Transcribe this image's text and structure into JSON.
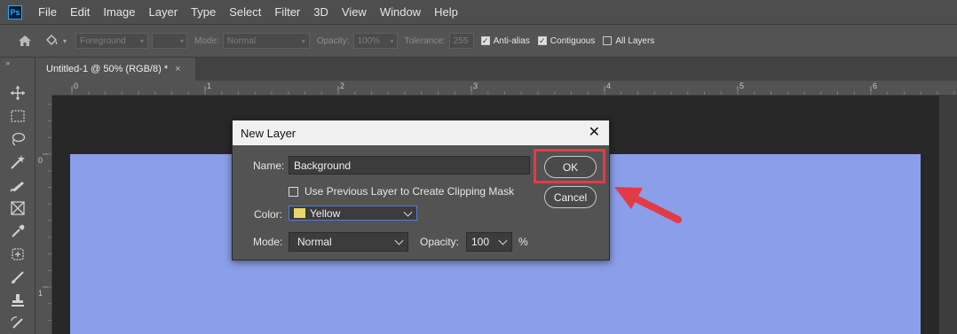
{
  "app": {
    "logo_text": "Ps"
  },
  "menu": [
    "File",
    "Edit",
    "Image",
    "Layer",
    "Type",
    "Select",
    "Filter",
    "3D",
    "View",
    "Window",
    "Help"
  ],
  "options": {
    "fill_source": "Foreground",
    "mode_label": "Mode:",
    "mode_value": "Normal",
    "opacity_label": "Opacity:",
    "opacity_value": "100%",
    "tolerance_label": "Tolerance:",
    "tolerance_value": "255",
    "anti_alias": "Anti-alias",
    "contiguous": "Contiguous",
    "all_layers": "All Layers"
  },
  "tab": {
    "title": "Untitled-1 @ 50% (RGB/8) *",
    "close": "×"
  },
  "ruler": {
    "h_ticks": [
      "0",
      "1",
      "2",
      "3",
      "4",
      "5",
      "6"
    ],
    "v_ticks": [
      "0",
      "1"
    ]
  },
  "dialog": {
    "title": "New Layer",
    "close": "✕",
    "name_label": "Name:",
    "name_value": "Background",
    "clip_label": "Use Previous Layer to Create Clipping Mask",
    "color_label": "Color:",
    "color_value": "Yellow",
    "mode_label": "Mode:",
    "mode_value": "Normal",
    "opacity_label": "Opacity:",
    "opacity_value": "100",
    "opacity_unit": "%",
    "ok": "OK",
    "cancel": "Cancel"
  },
  "colors": {
    "canvas": "#8b9ee9",
    "swatch_yellow": "#e8d76a",
    "annotation_red": "#e23b46",
    "brand_blue": "#31a8ff"
  }
}
